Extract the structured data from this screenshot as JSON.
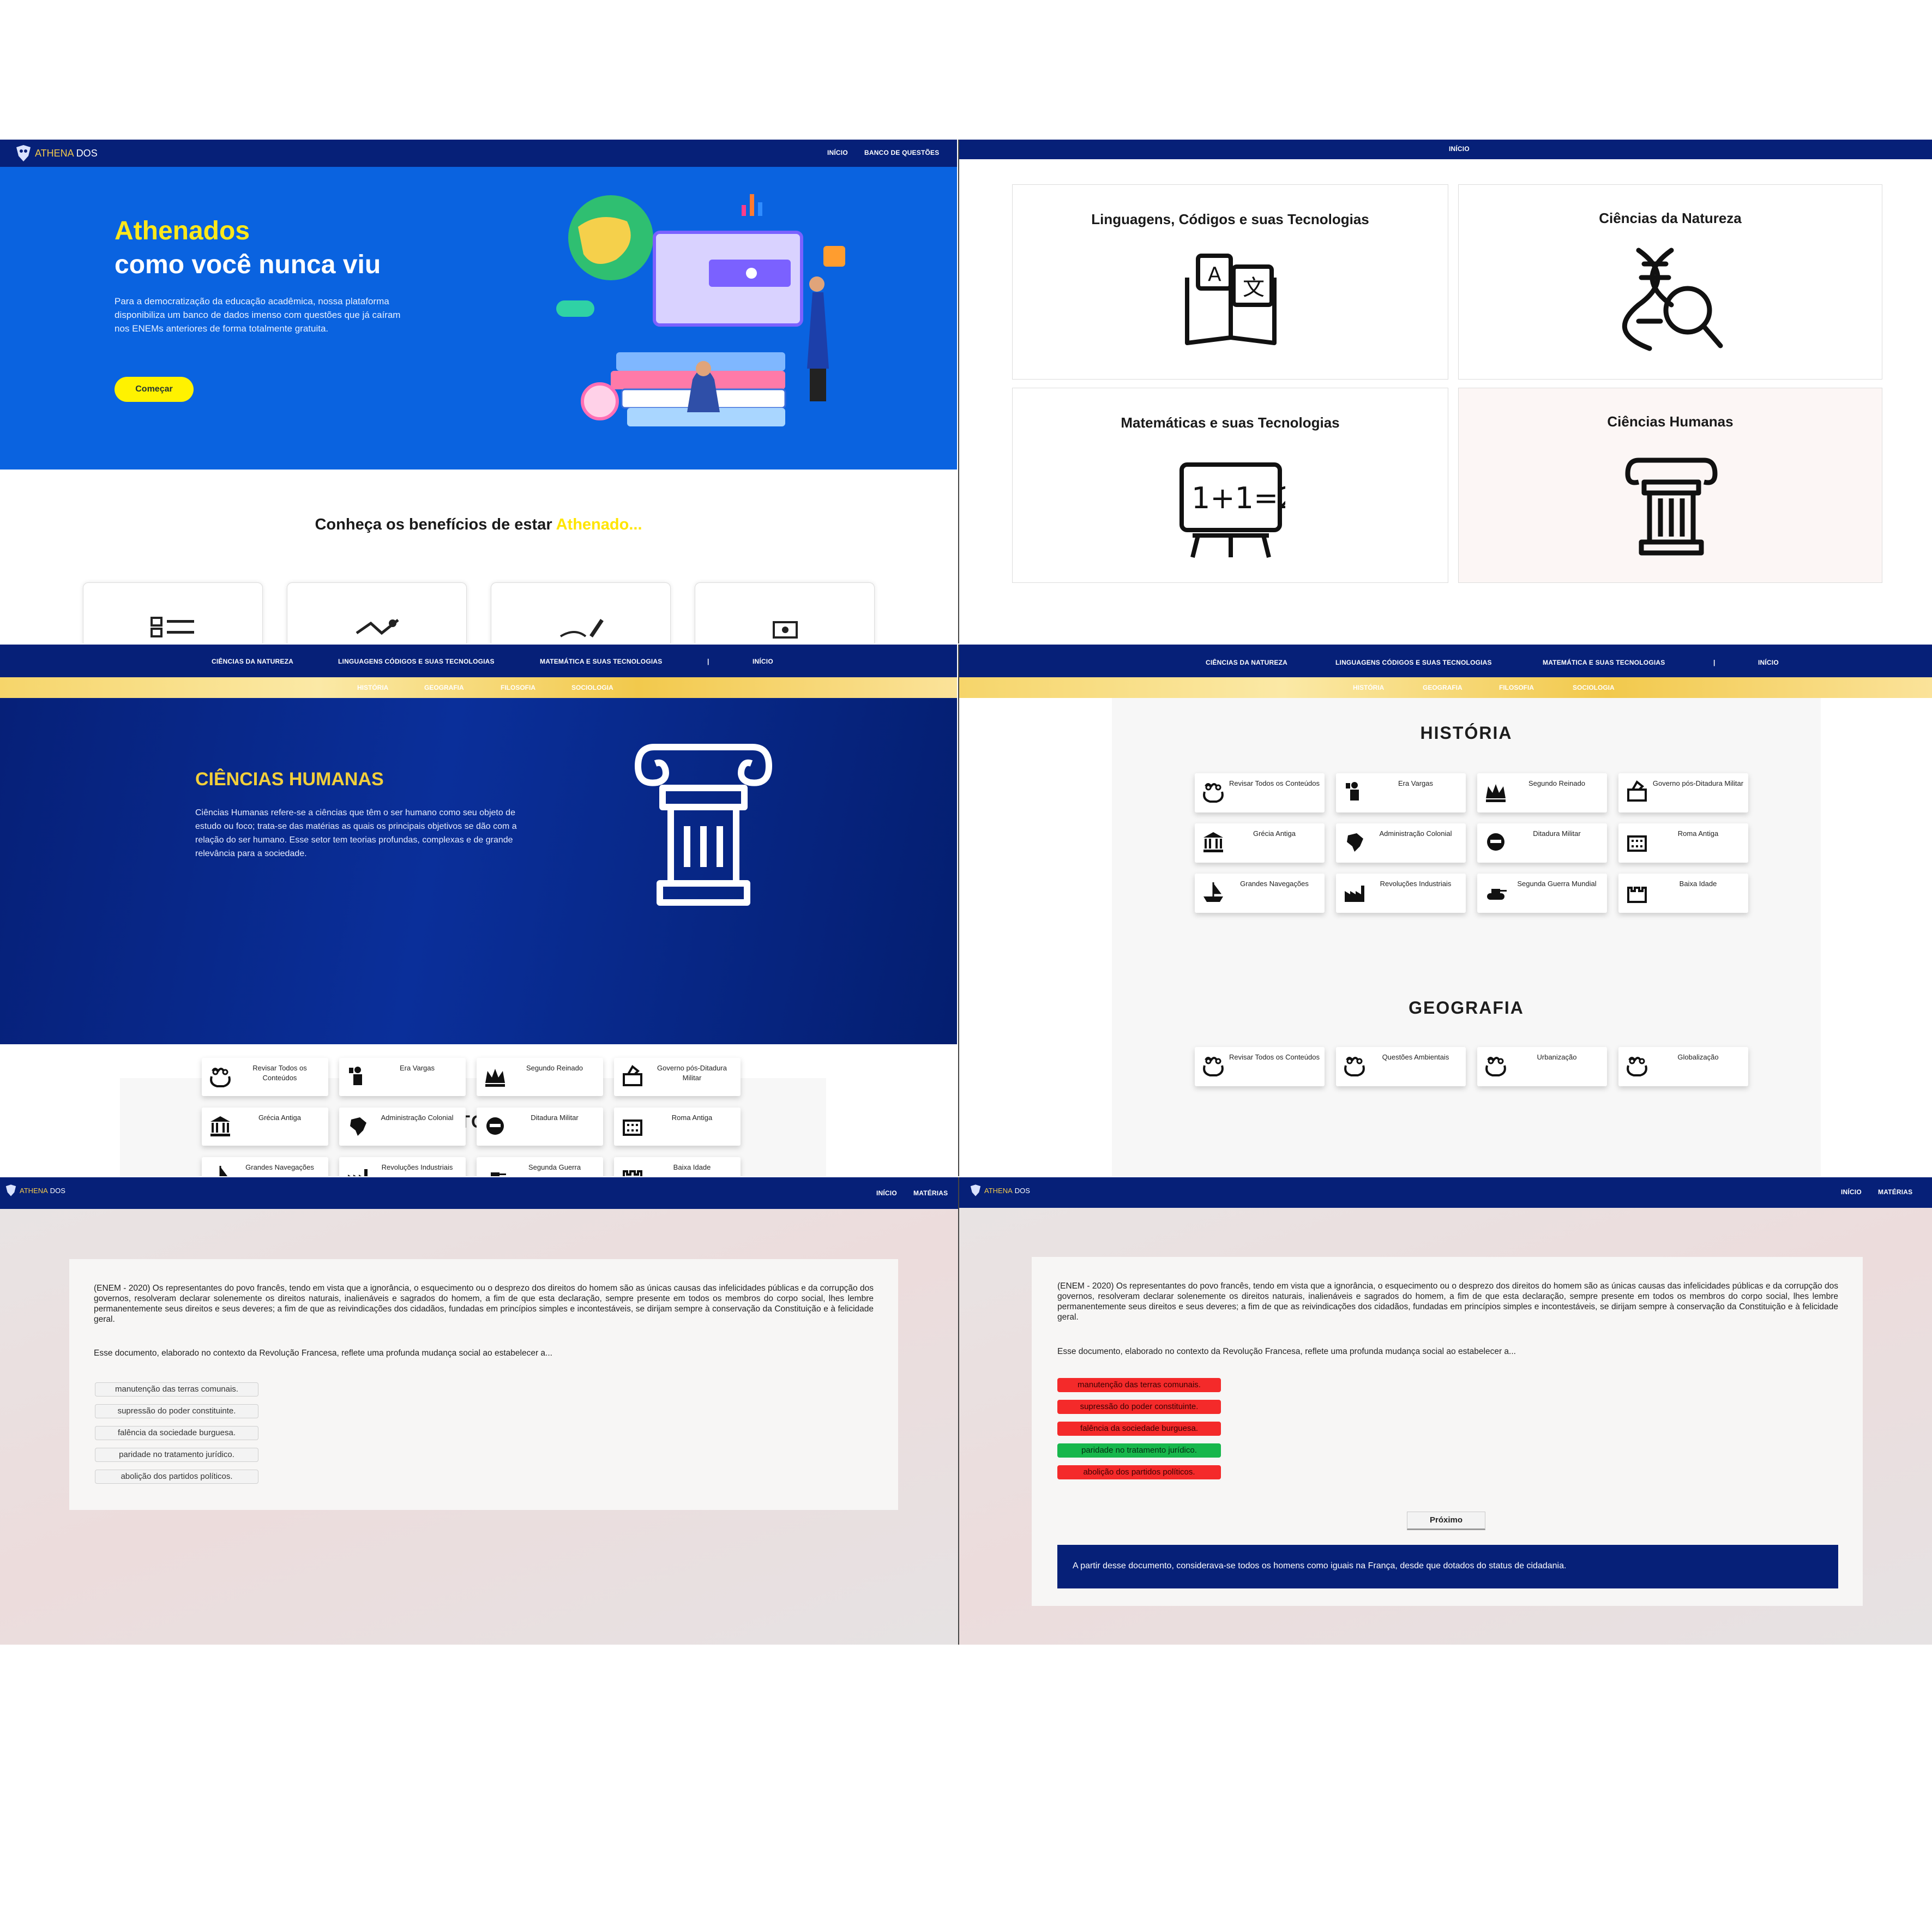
{
  "brand": {
    "logo_part1": "ATHENA",
    "logo_part2": "DOS"
  },
  "panel1": {
    "nav": {
      "inicio": "INÍCIO",
      "banco": "BANCO DE QUESTÕES"
    },
    "hero": {
      "title_line1": "Athenados",
      "title_line2": "como você nunca viu",
      "description": "Para a democratização da educação acadêmica, nossa plataforma disponibiliza um banco de dados imenso com questões que já caíram nos ENEMs anteriores de forma totalmente gratuita.",
      "cta": "Começar"
    },
    "benefits": {
      "heading": "Conheça os benefícios de estar ",
      "heading_accent": "Athenado..."
    }
  },
  "panel2": {
    "nav": {
      "inicio": "INÍCIO"
    },
    "areas": [
      {
        "title": "Linguagens, Códigos e suas Tecnologias",
        "icon": "translation-book-icon"
      },
      {
        "title": "Ciências da Natureza",
        "icon": "dna-magnifier-icon"
      },
      {
        "title": "Matemáticas e suas Tecnologias",
        "icon": "chalkboard-math-icon",
        "board_text": "1+1=2"
      },
      {
        "title": "Ciências Humanas",
        "icon": "column-icon"
      }
    ]
  },
  "subjects_nav": {
    "items": [
      "CIÊNCIAS DA NATUREZA",
      "LINGUAGENS CÓDIGOS E SUAS TECNOLOGIAS",
      "MATEMÁTICA E SUAS TECNOLOGIAS",
      "|",
      "INÍCIO"
    ],
    "sub_items": [
      "HISTÓRIA",
      "GEOGRAFIA",
      "FILOSOFIA",
      "SOCIOLOGIA"
    ]
  },
  "panel3": {
    "hero": {
      "title": "CIÊNCIAS HUMANAS",
      "description": "Ciências Humanas refere-se a ciências que têm o ser humano como seu objeto de estudo ou foco; trata-se das matérias as quais os principais objetivos se dão com a relação do ser humano. Esse setor tem teorias profundas, complexas e de grande relevância para a sociedade."
    },
    "historia_title": "HISTÓRIA",
    "historia_topics": [
      "Revisar Todos os Conteúdos",
      "Era Vargas",
      "Segundo Reinado",
      "Governo pós-Ditadura Militar",
      "Grécia Antiga",
      "Administração Colonial",
      "Ditadura Militar",
      "Roma Antiga",
      "Grandes Navegações",
      "Revoluções Industriais",
      "Segunda Guerra",
      "Baixa Idade"
    ]
  },
  "panel4": {
    "historia_title": "HISTÓRIA",
    "historia_topics": [
      "Revisar Todos os Conteúdos",
      "Era Vargas",
      "Segundo Reinado",
      "Governo pós-Ditadura Militar",
      "Grécia Antiga",
      "Administração Colonial",
      "Ditadura Militar",
      "Roma Antiga",
      "Grandes Navegações",
      "Revoluções Industriais",
      "Segunda Guerra Mundial",
      "Baixa Idade"
    ],
    "geografia_title": "GEOGRAFIA",
    "geografia_topics": [
      "Revisar Todos os Conteúdos",
      "Questões Ambientais",
      "Urbanização",
      "Globalização"
    ]
  },
  "quiz": {
    "nav": {
      "inicio": "INÍCIO",
      "materias": "MATÉRIAS"
    },
    "statement": "(ENEM - 2020) Os representantes do povo francês, tendo em vista que a ignorância, o esquecimento ou o desprezo dos direitos do homem são as únicas causas das infelicidades públicas e da corrupção dos governos, resolveram declarar solenemente os direitos naturais, inalienáveis e sagrados do homem, a fim de que esta declaração, sempre presente em todos os membros do corpo social, lhes lembre permanentemente seus direitos e seus deveres; a fim de que as reivindicações dos cidadãos, fundadas em princípios simples e incontestáveis, se dirijam sempre à conservação da Constituição e à felicidade geral.",
    "question": "Esse documento, elaborado no contexto da Revolução Francesa, reflete uma profunda mudança social ao estabelecer a...",
    "options": [
      "manutenção das terras comunais.",
      "supressão do poder constituinte.",
      "falência da sociedade burguesa.",
      "paridade no tratamento jurídico.",
      "abolição dos partidos políticos."
    ],
    "next_button": "Próximo",
    "explanation": "A partir desse documento, considerava-se todos os homens como iguais na França, desde que dotados do status de cidadania.",
    "colors": {
      "wrong": "#f42a2a",
      "right": "#17b74c",
      "nav": "#062078"
    }
  }
}
